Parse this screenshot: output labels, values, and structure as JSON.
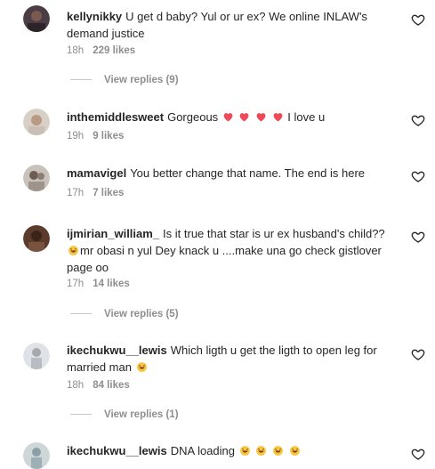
{
  "comments": [
    {
      "user": "kellynikky",
      "text": "U get d baby? Yul or ur ex? We online INLAW's demand justice",
      "time": "18h",
      "likes": "229 likes",
      "avatar_color": "#4a3e44"
    },
    {
      "user": "inthemiddlesweet",
      "text": "Gorgeous",
      "text_after": "I love u",
      "time": "19h",
      "likes": "9 likes",
      "avatar_color": "#c9bfb4"
    },
    {
      "user": "mamavigel",
      "text": "You better change that name. The end is here",
      "time": "17h",
      "likes": "7 likes",
      "avatar_color": "#8a7f76"
    },
    {
      "user": "ijmirian_william_",
      "text": "Is it true that star is ur ex husband's child??",
      "text_line2": "mr obasi n yul Dey knack u ....make una go check gistlover page oo",
      "time": "17h",
      "likes": "14 likes",
      "avatar_color": "#5b3c2c"
    },
    {
      "user": "ikechukwu__lewis",
      "text": "Which ligth u get the ligth to open leg for married man",
      "time": "18h",
      "likes": "84 likes",
      "avatar_color": "#a7a9ae"
    },
    {
      "user": "ikechukwu__lewis",
      "text": "DNA loading",
      "avatar_color": "#8aa0a8"
    }
  ],
  "view_replies": [
    "View replies (9)",
    "View replies (5)",
    "View replies (1)"
  ],
  "colors": {
    "text": "#262626",
    "meta": "#8e8e8e",
    "heart_red": "#ed4956",
    "emoji_yellow": "#f7c640"
  }
}
